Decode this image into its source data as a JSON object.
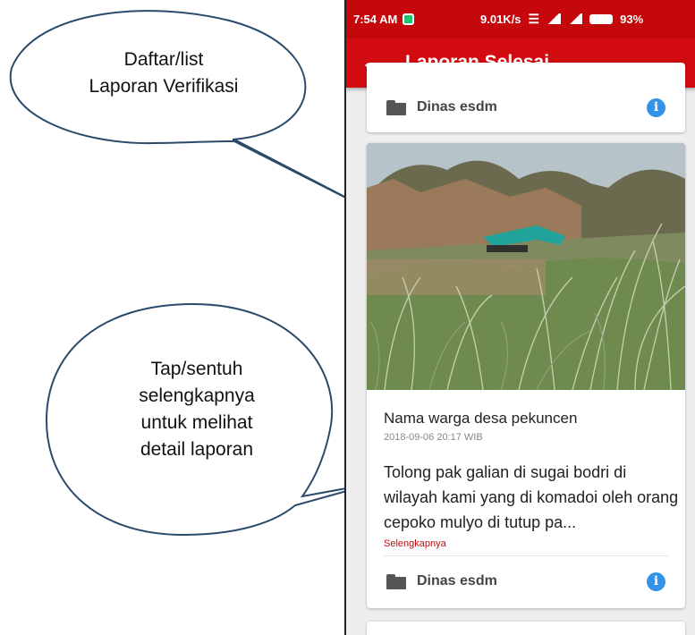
{
  "callouts": {
    "list": {
      "line1": "Daftar/list",
      "line2": "Laporan Verifikasi"
    },
    "tap": {
      "line1": "Tap/sentuh",
      "line2": "selengkapnya",
      "line3": "untuk melihat",
      "line4": "detail laporan"
    }
  },
  "statusbar": {
    "time": "7:54 AM",
    "speed": "9.01K/s",
    "battery": "93%"
  },
  "appbar": {
    "back_icon": "←",
    "title": "Laporan Selesai"
  },
  "cards": [
    {
      "department": "Dinas esdm"
    },
    {
      "reporter": "Nama warga desa pekuncen",
      "timestamp": "2018-09-06 20:17 WIB",
      "excerpt": "Tolong pak galian di sugai bodri di wilayah kami yang di komadoi oleh orang cepoko mulyo di tutup pa...",
      "more_label": "Selengkapnya",
      "department": "Dinas esdm"
    }
  ],
  "icons": {
    "folder": "folder-icon",
    "info": "info-icon",
    "info_glyph": "i",
    "back": "arrow-left-icon"
  },
  "colors": {
    "statusbar": "#c5080b",
    "appbar": "#d10b0f",
    "info": "#3393e8",
    "link": "#c5080b"
  }
}
